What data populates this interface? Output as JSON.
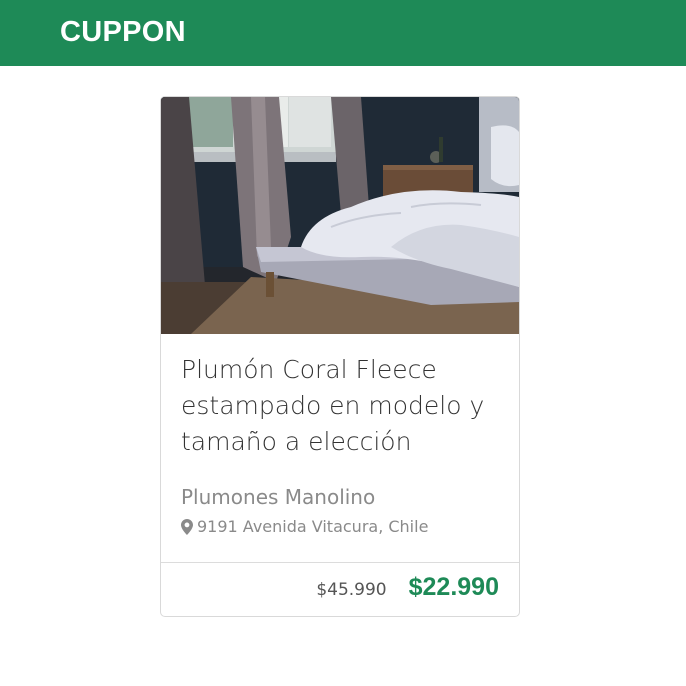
{
  "header": {
    "logo": "CUPPON",
    "brand_color": "#1e8a57"
  },
  "deal": {
    "image_alt": "bedroom-bed-photo",
    "title": "Plumón Coral Fleece estampado en modelo y tamaño a elección",
    "merchant": "Plumones Manolino",
    "address": "9191 Avenida Vitacura, Chile",
    "address_icon": "map-pin-icon",
    "original_price": "$45.990",
    "price": "$22.990"
  }
}
